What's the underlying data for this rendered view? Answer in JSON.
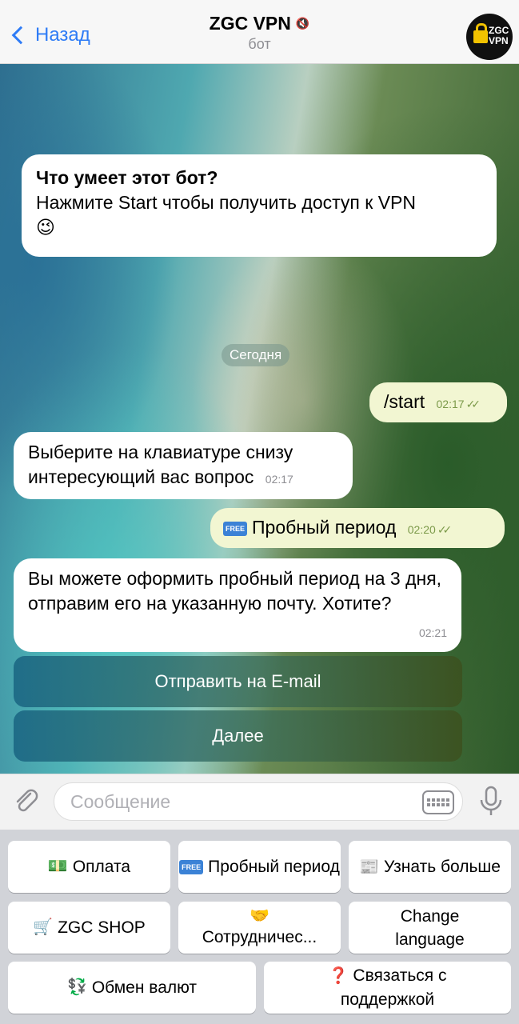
{
  "header": {
    "back_label": "Назад",
    "title": "ZGC VPN",
    "subtitle": "бот",
    "avatar_text": "ZGC VPN"
  },
  "intro": {
    "title": "Что умеет этот бот?",
    "text": "Нажмите Start чтобы получить доступ к VPN",
    "emoji": "😉"
  },
  "date_separator": "Сегодня",
  "messages": [
    {
      "text": "/start",
      "time": "02:17",
      "direction": "out"
    },
    {
      "text": "Выберите на клавиатуре снизу интересующий вас вопрос",
      "time": "02:17",
      "direction": "in"
    },
    {
      "text": "Пробный период",
      "time": "02:20",
      "direction": "out",
      "badge": "FREE"
    },
    {
      "text": "Вы можете оформить пробный период на 3 дня, отправим его на указанную почту. Хотите?",
      "time": "02:21",
      "direction": "in"
    }
  ],
  "inline_buttons": [
    "Отправить на E-mail",
    "Далее"
  ],
  "composer": {
    "placeholder": "Сообщение"
  },
  "keyboard": {
    "pay": {
      "emoji": "💵",
      "label": "Оплата"
    },
    "trial": {
      "badge": "FREE",
      "label": "Пробный период"
    },
    "more": {
      "emoji": "📰",
      "label": "Узнать больше"
    },
    "shop": {
      "emoji": "🛒",
      "label": "ZGC SHOP"
    },
    "partner": {
      "emoji": "🤝",
      "label": "Сотрудничес..."
    },
    "lang": {
      "label": "Change language"
    },
    "exchange": {
      "emoji": "💱",
      "label": "Обмен валют"
    },
    "support": {
      "emoji": "❓",
      "label": "Связаться с поддержкой"
    }
  },
  "colors": {
    "link_blue": "#2f7cf6",
    "outgoing_bubble": "#f2f6d2",
    "check_green": "#7c9a4a"
  }
}
